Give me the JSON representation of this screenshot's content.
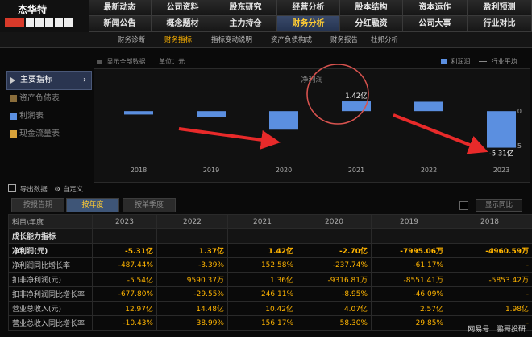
{
  "header": {
    "stock_name": "杰华特",
    "nav_row1": [
      "最新动态",
      "公司资料",
      "股东研究",
      "经营分析",
      "股本结构",
      "资本运作",
      "盈利预测"
    ],
    "nav_row2": [
      "新闻公告",
      "概念题材",
      "主力持仓",
      "财务分析",
      "分红融资",
      "公司大事",
      "行业对比"
    ],
    "active_nav": "财务分析"
  },
  "subnav": {
    "items": [
      "财务诊断",
      "财务指标",
      "指标变动说明",
      "资产负债构成",
      "财务报告",
      "杜邦分析"
    ],
    "active": "财务指标"
  },
  "side_menu": [
    {
      "label": "主要指标",
      "active": true
    },
    {
      "label": "资产负债表",
      "active": false
    },
    {
      "label": "利润表",
      "active": false
    },
    {
      "label": "现金流量表",
      "active": false
    }
  ],
  "chart_options": {
    "show_all": "显示全部数据",
    "unit": "单位：元"
  },
  "legend": {
    "series": "利润润",
    "industry": "行业平均"
  },
  "chart_data": {
    "type": "bar",
    "title": "净利润",
    "categories": [
      "2018",
      "2019",
      "2020",
      "2021",
      "2022",
      "2023"
    ],
    "values": [
      -0.496,
      -0.7995,
      -2.7,
      1.42,
      1.37,
      -5.31
    ],
    "ylim": [
      -7,
      4
    ],
    "yticks": [
      "0",
      "-5"
    ],
    "data_labels": {
      "2021": "1.42亿",
      "2023": "-5.31亿"
    }
  },
  "toolbar": {
    "export": "导出数据",
    "custom": "自定义"
  },
  "tabs": [
    "按报告期",
    "按年度",
    "按单季度"
  ],
  "active_tab": "按年度",
  "compare": "显示同比",
  "table": {
    "columns": [
      "科目\\年度",
      "2023",
      "2022",
      "2021",
      "2020",
      "2019",
      "2018"
    ],
    "section": "成长能力指标",
    "rows": [
      {
        "label": "净利润(元)",
        "values": [
          "-5.31亿",
          "1.37亿",
          "1.42亿",
          "-2.70亿",
          "-7995.06万",
          "-4960.59万"
        ],
        "bold": true
      },
      {
        "label": "净利润同比增长率",
        "values": [
          "-487.44%",
          "-3.39%",
          "152.58%",
          "-237.74%",
          "-61.17%",
          "-"
        ]
      },
      {
        "label": "扣非净利润(元)",
        "values": [
          "-5.54亿",
          "9590.37万",
          "1.36亿",
          "-9316.81万",
          "-8551.41万",
          "-5853.42万"
        ]
      },
      {
        "label": "扣非净利润同比增长率",
        "values": [
          "-677.80%",
          "-29.55%",
          "246.11%",
          "-8.95%",
          "-46.09%",
          "-"
        ]
      },
      {
        "label": "营业总收入(元)",
        "values": [
          "12.97亿",
          "14.48亿",
          "10.42亿",
          "4.07亿",
          "2.57亿",
          "1.98亿"
        ]
      },
      {
        "label": "营业总收入同比增长率",
        "values": [
          "-10.43%",
          "38.99%",
          "156.17%",
          "58.30%",
          "29.85%",
          "-"
        ]
      }
    ]
  },
  "watermark": "网易号 | 鹏哥投研",
  "colors": {
    "bar": "#5b8fe0",
    "accent": "#ffb400",
    "circle": "#d9534f",
    "arrow": "#e82a2a"
  }
}
